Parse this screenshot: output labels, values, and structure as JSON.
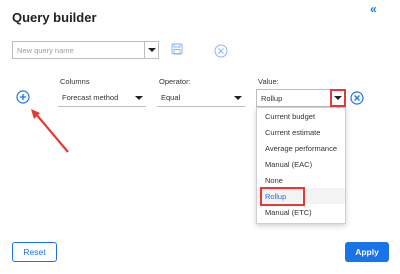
{
  "header": {
    "title": "Query builder",
    "collapse_glyph": "«"
  },
  "query": {
    "name_placeholder": "New query name"
  },
  "labels": {
    "columns": "Columns",
    "operator": "Operator:",
    "value": "Value:"
  },
  "row": {
    "column_value": "Forecast method",
    "operator_value": "Equal",
    "value_value": "Rollup"
  },
  "dropdown": {
    "options": [
      "Current budget",
      "Current estimate",
      "Average performance",
      "Manual (EAC)",
      "None",
      "Rollup",
      "Manual (ETC)"
    ],
    "selected": "Rollup"
  },
  "footer": {
    "reset_label": "Reset",
    "apply_label": "Apply"
  },
  "colors": {
    "accent": "#1a73e8",
    "highlight": "#e53935"
  },
  "icons": [
    "collapse-icon",
    "save-icon",
    "clear-icon",
    "add-icon",
    "remove-icon",
    "chevron-down-icon"
  ]
}
